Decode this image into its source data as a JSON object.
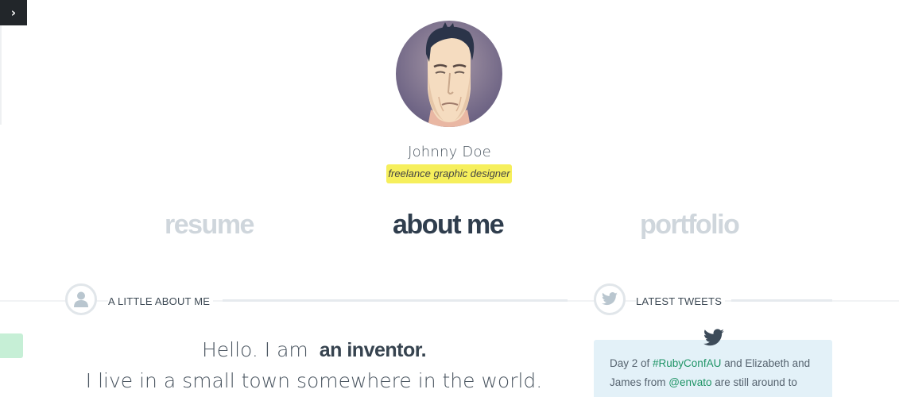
{
  "menu": {
    "toggle_glyph": "›"
  },
  "profile": {
    "name": "Johnny Doe",
    "role": "freelance graphic designer"
  },
  "nav": {
    "resume": "resume",
    "about": "about me",
    "portfolio": "portfolio",
    "active": "about me"
  },
  "about_section": {
    "title": "A LITTLE ABOUT ME",
    "hello_prefix": "Hello. I am",
    "hello_highlight": "an inventor.",
    "line2": "I live in a small town somewhere in the world."
  },
  "tweets_section": {
    "title": "LATEST TWEETS",
    "tweet": {
      "t1": "Day 2 of ",
      "hashtag": "#RubyConfAU",
      "t2": " and Elizabeth and James from ",
      "mention": "@envato",
      "t3": " are still around to"
    }
  },
  "colors": {
    "accent_yellow": "#f6ef5c",
    "active_nav": "#2f3d4d",
    "inactive_nav": "#cfd6dc",
    "link_green": "#1f9466",
    "tweet_bg": "#e3f1f8"
  },
  "icons": {
    "menu": "chevron-right-icon",
    "about": "user-icon",
    "tweets": "twitter-bird-icon"
  }
}
